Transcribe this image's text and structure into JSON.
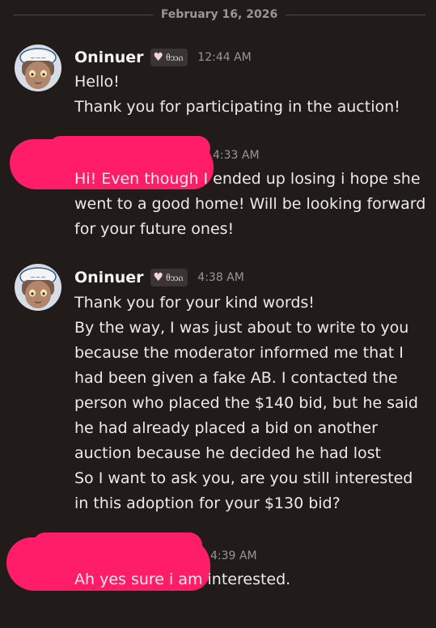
{
  "divider": {
    "date": "February 16, 2026"
  },
  "messages": [
    {
      "author": "Oninuer",
      "tag": "ᦲᦘᦵ",
      "time": "12:44 AM",
      "lines": [
        "Hello!",
        "Thank you for participating in the auction!"
      ]
    },
    {
      "time": "4:33 AM",
      "lines": [
        "Hi! Even though I ended up losing i hope she",
        "went to a good home! Will be looking forward",
        "for your future ones!"
      ]
    },
    {
      "author": "Oninuer",
      "tag": "ᦲᦘᦵ",
      "time": "4:38 AM",
      "lines": [
        "Thank you for your kind words!",
        "By the way, I was just about to write to you",
        "because the moderator informed me that I",
        "had been given a fake AB. I contacted the",
        "person who placed the $140 bid, but he said",
        "he had already placed a bid on another",
        "auction because he decided he had lost",
        "So I want to ask you, are you still interested",
        "in this adoption for your $130 bid?"
      ]
    },
    {
      "time": "4:39 AM",
      "lines": [
        "Ah yes sure i am interested."
      ]
    }
  ],
  "colors": {
    "background": "#211b1a",
    "redaction": "#ff1d6a",
    "text": "#ecebe9",
    "muted": "#9a9694"
  }
}
